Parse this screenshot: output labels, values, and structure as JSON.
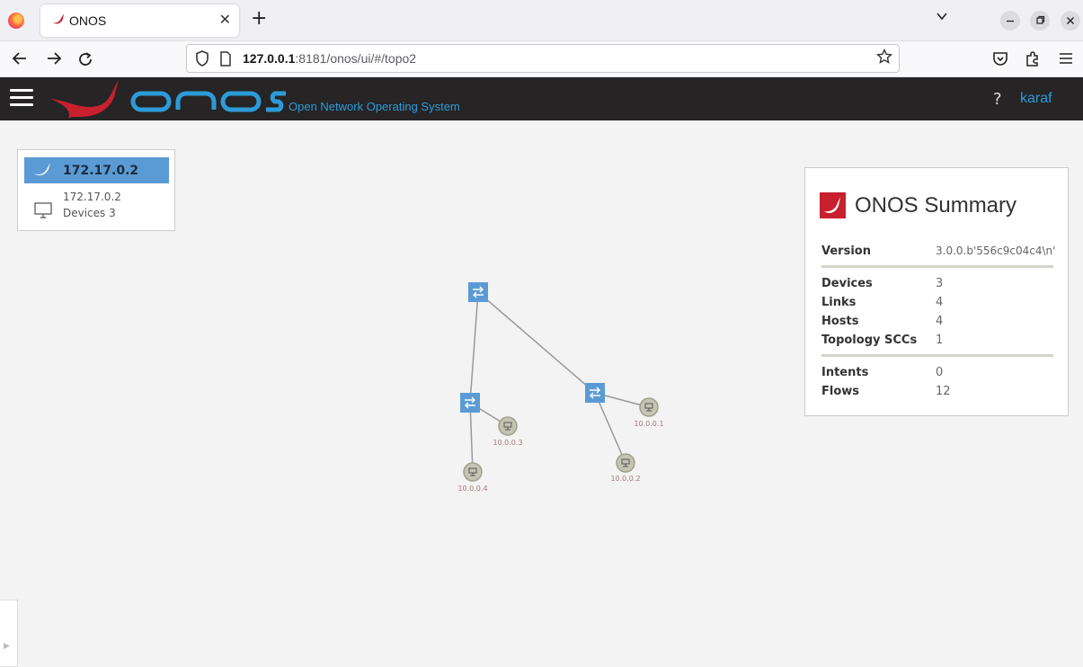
{
  "browser": {
    "tab_title": "ONOS",
    "url_host": "127.0.0.1",
    "url_rest": ":8181/onos/ui/#/topo2",
    "tab_close_glyph": "✕",
    "new_tab_glyph": "+"
  },
  "header": {
    "subtitle": "Open Network Operating System",
    "help_glyph": "?",
    "user": "karaf"
  },
  "cluster": {
    "title": "172.17.0.2",
    "ip": "172.17.0.2",
    "devices": "Devices 3"
  },
  "topology": {
    "hosts": [
      "10.0.0.1",
      "10.0.0.2",
      "10.0.0.3",
      "10.0.0.4"
    ]
  },
  "summary": {
    "title": "ONOS Summary",
    "version_label": "Version",
    "version_value": "3.0.0.b'556c9c04c4\\n'",
    "rows1": [
      {
        "label": "Devices",
        "value": "3"
      },
      {
        "label": "Links",
        "value": "4"
      },
      {
        "label": "Hosts",
        "value": "4"
      },
      {
        "label": "Topology SCCs",
        "value": "1"
      }
    ],
    "rows2": [
      {
        "label": "Intents",
        "value": "0"
      },
      {
        "label": "Flows",
        "value": "12"
      }
    ]
  },
  "colors": {
    "accent_blue": "#2d9bd8",
    "onos_red": "#c8202e",
    "switch_blue": "#5a9bd5"
  }
}
